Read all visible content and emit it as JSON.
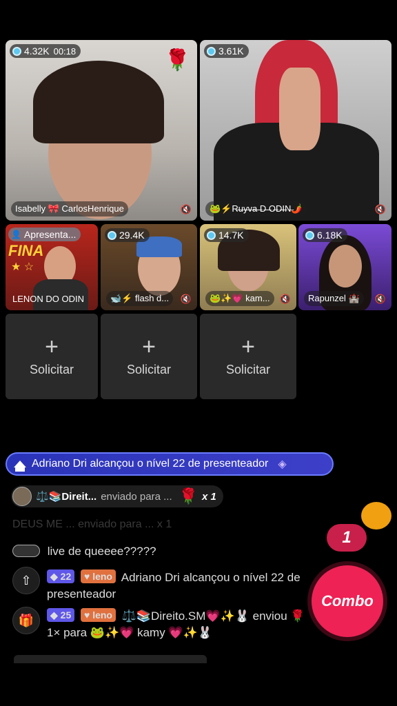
{
  "tiles": [
    {
      "viewers": "4.32K",
      "timer": "00:18",
      "name": "Isabelly 🎀 CarlosHenrique",
      "corner_emoji": "🌹"
    },
    {
      "viewers": "3.61K",
      "name": "🐸⚡R̶u̶y̶v̶a̶ ̶D̶ ̶O̶D̶I̶N̶🌶️"
    },
    {
      "badge": "Apresenta...",
      "name": "LENON DO ODIN",
      "logo_text": "FINA"
    },
    {
      "viewers": "29.4K",
      "name": "🐋⚡ flash d..."
    },
    {
      "viewers": "14.7K",
      "name": "🐸✨💗 kam..."
    },
    {
      "viewers": "6.18K",
      "name": "Rapunzel 🏰"
    }
  ],
  "request_slots": [
    {
      "label": "Solicitar"
    },
    {
      "label": "Solicitar"
    },
    {
      "label": "Solicitar"
    }
  ],
  "level_banner": {
    "text": "Adriano Dri alcançou o nível 22 de presenteador"
  },
  "gift": {
    "sender": "⚖️📚Direit...",
    "sent_text": "enviado para ...",
    "count": "x 1",
    "gift_emoji": "🌹"
  },
  "faded_line": {
    "text": "DEUS ME ... enviado para ... x 1"
  },
  "chat": [
    {
      "text": "live de queeee?????"
    },
    {
      "level": "22",
      "fan": "leno",
      "text": "Adriano Dri alcançou o nível 22 de presenteador"
    },
    {
      "level": "25",
      "fan": "leno",
      "text": "⚖️📚Direito.SM💗✨🐰 enviou 🌹 1× para 🐸✨💗 kamy 💗✨🐰"
    }
  ],
  "combo": {
    "label": "Combo",
    "count": "1"
  },
  "colors": {
    "banner": "#3d3fc8",
    "combo": "#ee2255",
    "solicit_bg": "#2a2a2a"
  }
}
